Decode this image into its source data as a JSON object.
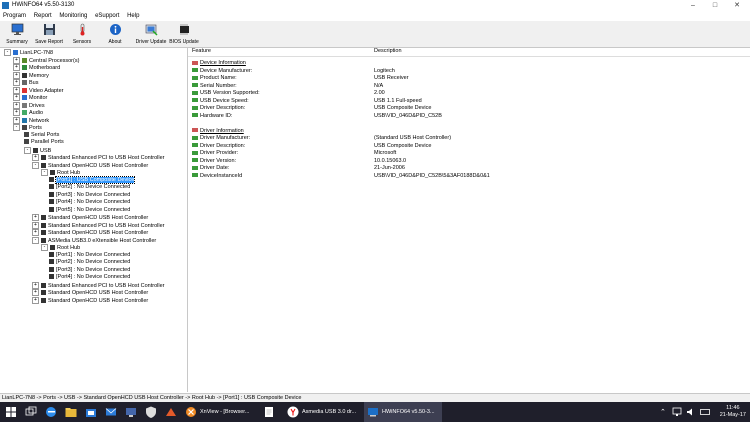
{
  "window": {
    "title": "HWiNFO64 v5.50-3130"
  },
  "menu": [
    "Program",
    "Report",
    "Monitoring",
    "eSupport",
    "Help"
  ],
  "toolbar": [
    {
      "label": "Summary",
      "icon": "monitor-icon"
    },
    {
      "label": "Save Report",
      "icon": "save-icon"
    },
    {
      "label": "Sensors",
      "icon": "thermometer-icon"
    },
    {
      "label": "About",
      "icon": "info-icon"
    },
    {
      "label": "Driver Update",
      "icon": "driver-update-icon"
    },
    {
      "label": "BIOS Update",
      "icon": "bios-chip-icon"
    }
  ],
  "tree": [
    {
      "label": "LianLPC-7N8",
      "level": 0,
      "toggle": "-",
      "icon": "computer-icon"
    },
    {
      "label": "Central Processor(s)",
      "level": 1,
      "toggle": "+",
      "icon": "cpu-icon"
    },
    {
      "label": "Motherboard",
      "level": 1,
      "toggle": "+",
      "icon": "motherboard-icon"
    },
    {
      "label": "Memory",
      "level": 1,
      "toggle": "+",
      "icon": "memory-icon"
    },
    {
      "label": "Bus",
      "level": 1,
      "toggle": "+",
      "icon": "bus-icon"
    },
    {
      "label": "Video Adapter",
      "level": 1,
      "toggle": "+",
      "icon": "video-icon"
    },
    {
      "label": "Monitor",
      "level": 1,
      "toggle": "+",
      "icon": "monitor-icon"
    },
    {
      "label": "Drives",
      "level": 1,
      "toggle": "+",
      "icon": "drive-icon"
    },
    {
      "label": "Audio",
      "level": 1,
      "toggle": "+",
      "icon": "audio-icon"
    },
    {
      "label": "Network",
      "level": 1,
      "toggle": "+",
      "icon": "network-icon"
    },
    {
      "label": "Ports",
      "level": 1,
      "toggle": "-",
      "icon": "port-icon"
    },
    {
      "label": "Serial Ports",
      "level": 2,
      "toggle": "",
      "icon": "port-icon"
    },
    {
      "label": "Parallel Ports",
      "level": 2,
      "toggle": "",
      "icon": "port-icon"
    },
    {
      "label": "USB",
      "level": 2,
      "toggle": "-",
      "icon": "usb-icon"
    },
    {
      "label": "Standard Enhanced PCI to USB Host Controller",
      "level": 3,
      "toggle": "+",
      "icon": "usb-icon"
    },
    {
      "label": "Standard OpenHCD USB Host Controller",
      "level": 3,
      "toggle": "-",
      "icon": "usb-icon"
    },
    {
      "label": "Root Hub",
      "level": 4,
      "toggle": "-",
      "icon": "usb-icon"
    },
    {
      "label": "[Port1] : USB Composite Device",
      "level": 5,
      "toggle": "",
      "icon": "usb-plug-icon",
      "selected": true
    },
    {
      "label": "[Port2] : No Device Connected",
      "level": 5,
      "toggle": "",
      "icon": "usb-plug-icon"
    },
    {
      "label": "[Port3] : No Device Connected",
      "level": 5,
      "toggle": "",
      "icon": "usb-plug-icon"
    },
    {
      "label": "[Port4] : No Device Connected",
      "level": 5,
      "toggle": "",
      "icon": "usb-plug-icon"
    },
    {
      "label": "[Port5] : No Device Connected",
      "level": 5,
      "toggle": "",
      "icon": "usb-plug-icon"
    },
    {
      "label": "Standard OpenHCD USB Host Controller",
      "level": 3,
      "toggle": "+",
      "icon": "usb-icon"
    },
    {
      "label": "Standard Enhanced PCI to USB Host Controller",
      "level": 3,
      "toggle": "+",
      "icon": "usb-icon"
    },
    {
      "label": "Standard OpenHCD USB Host Controller",
      "level": 3,
      "toggle": "+",
      "icon": "usb-icon"
    },
    {
      "label": "ASMedia USB3.0 eXtensible Host Controller",
      "level": 3,
      "toggle": "-",
      "icon": "usb-icon"
    },
    {
      "label": "Root Hub",
      "level": 4,
      "toggle": "-",
      "icon": "usb-icon"
    },
    {
      "label": "[Port1] : No Device Connected",
      "level": 5,
      "toggle": "",
      "icon": "usb-plug-icon"
    },
    {
      "label": "[Port2] : No Device Connected",
      "level": 5,
      "toggle": "",
      "icon": "usb-plug-icon"
    },
    {
      "label": "[Port3] : No Device Connected",
      "level": 5,
      "toggle": "",
      "icon": "usb-plug-icon"
    },
    {
      "label": "[Port4] : No Device Connected",
      "level": 5,
      "toggle": "",
      "icon": "usb-plug-icon"
    },
    {
      "label": "Standard Enhanced PCI to USB Host Controller",
      "level": 3,
      "toggle": "+",
      "icon": "usb-icon"
    },
    {
      "label": "Standard OpenHCD USB Host Controller",
      "level": 3,
      "toggle": "+",
      "icon": "usb-icon"
    },
    {
      "label": "Standard OpenHCD USB Host Controller",
      "level": 3,
      "toggle": "+",
      "icon": "usb-icon"
    }
  ],
  "details": {
    "headers": {
      "feature": "Feature",
      "description": "Description"
    },
    "rows": [
      {
        "feature": "Device Information",
        "value": "",
        "section": true
      },
      {
        "feature": "Device Manufacturer:",
        "value": "Logitech"
      },
      {
        "feature": "Product Name:",
        "value": "USB Receiver"
      },
      {
        "feature": "Serial Number:",
        "value": "N/A"
      },
      {
        "feature": "USB Version Supported:",
        "value": "2.00"
      },
      {
        "feature": "USB Device Speed:",
        "value": "USB 1.1 Full-speed"
      },
      {
        "feature": "Driver Description:",
        "value": "USB Composite Device"
      },
      {
        "feature": "Hardware ID:",
        "value": "USB\\VID_046D&PID_C52B"
      },
      {
        "feature": "",
        "value": "",
        "blank": true
      },
      {
        "feature": "Driver Information",
        "value": "",
        "section": true
      },
      {
        "feature": "Driver Manufacturer:",
        "value": "(Standard USB Host Controller)"
      },
      {
        "feature": "Driver Description:",
        "value": "USB Composite Device"
      },
      {
        "feature": "Driver Provider:",
        "value": "Microsoft"
      },
      {
        "feature": "Driver Version:",
        "value": "10.0.15063.0"
      },
      {
        "feature": "Driver Date:",
        "value": "21-Jun-2006"
      },
      {
        "feature": "DeviceInstanceId",
        "value": "USB\\VID_046D&PID_C52B\\5&3AF0188D&0&1"
      }
    ]
  },
  "status": "LianLPC-7N8 -> Ports -> USB -> Standard OpenHCD USB Host Controller -> Root Hub -> [Port1] : USB Composite Device",
  "taskbar": {
    "apps": [
      {
        "label": "XnView - [Browser..."
      },
      {
        "label": "Asmedia USB 3.0 dr..."
      },
      {
        "label": "HWiNFO64 v5.50-3..."
      }
    ],
    "time": "11:46",
    "date": "21-May-17"
  }
}
